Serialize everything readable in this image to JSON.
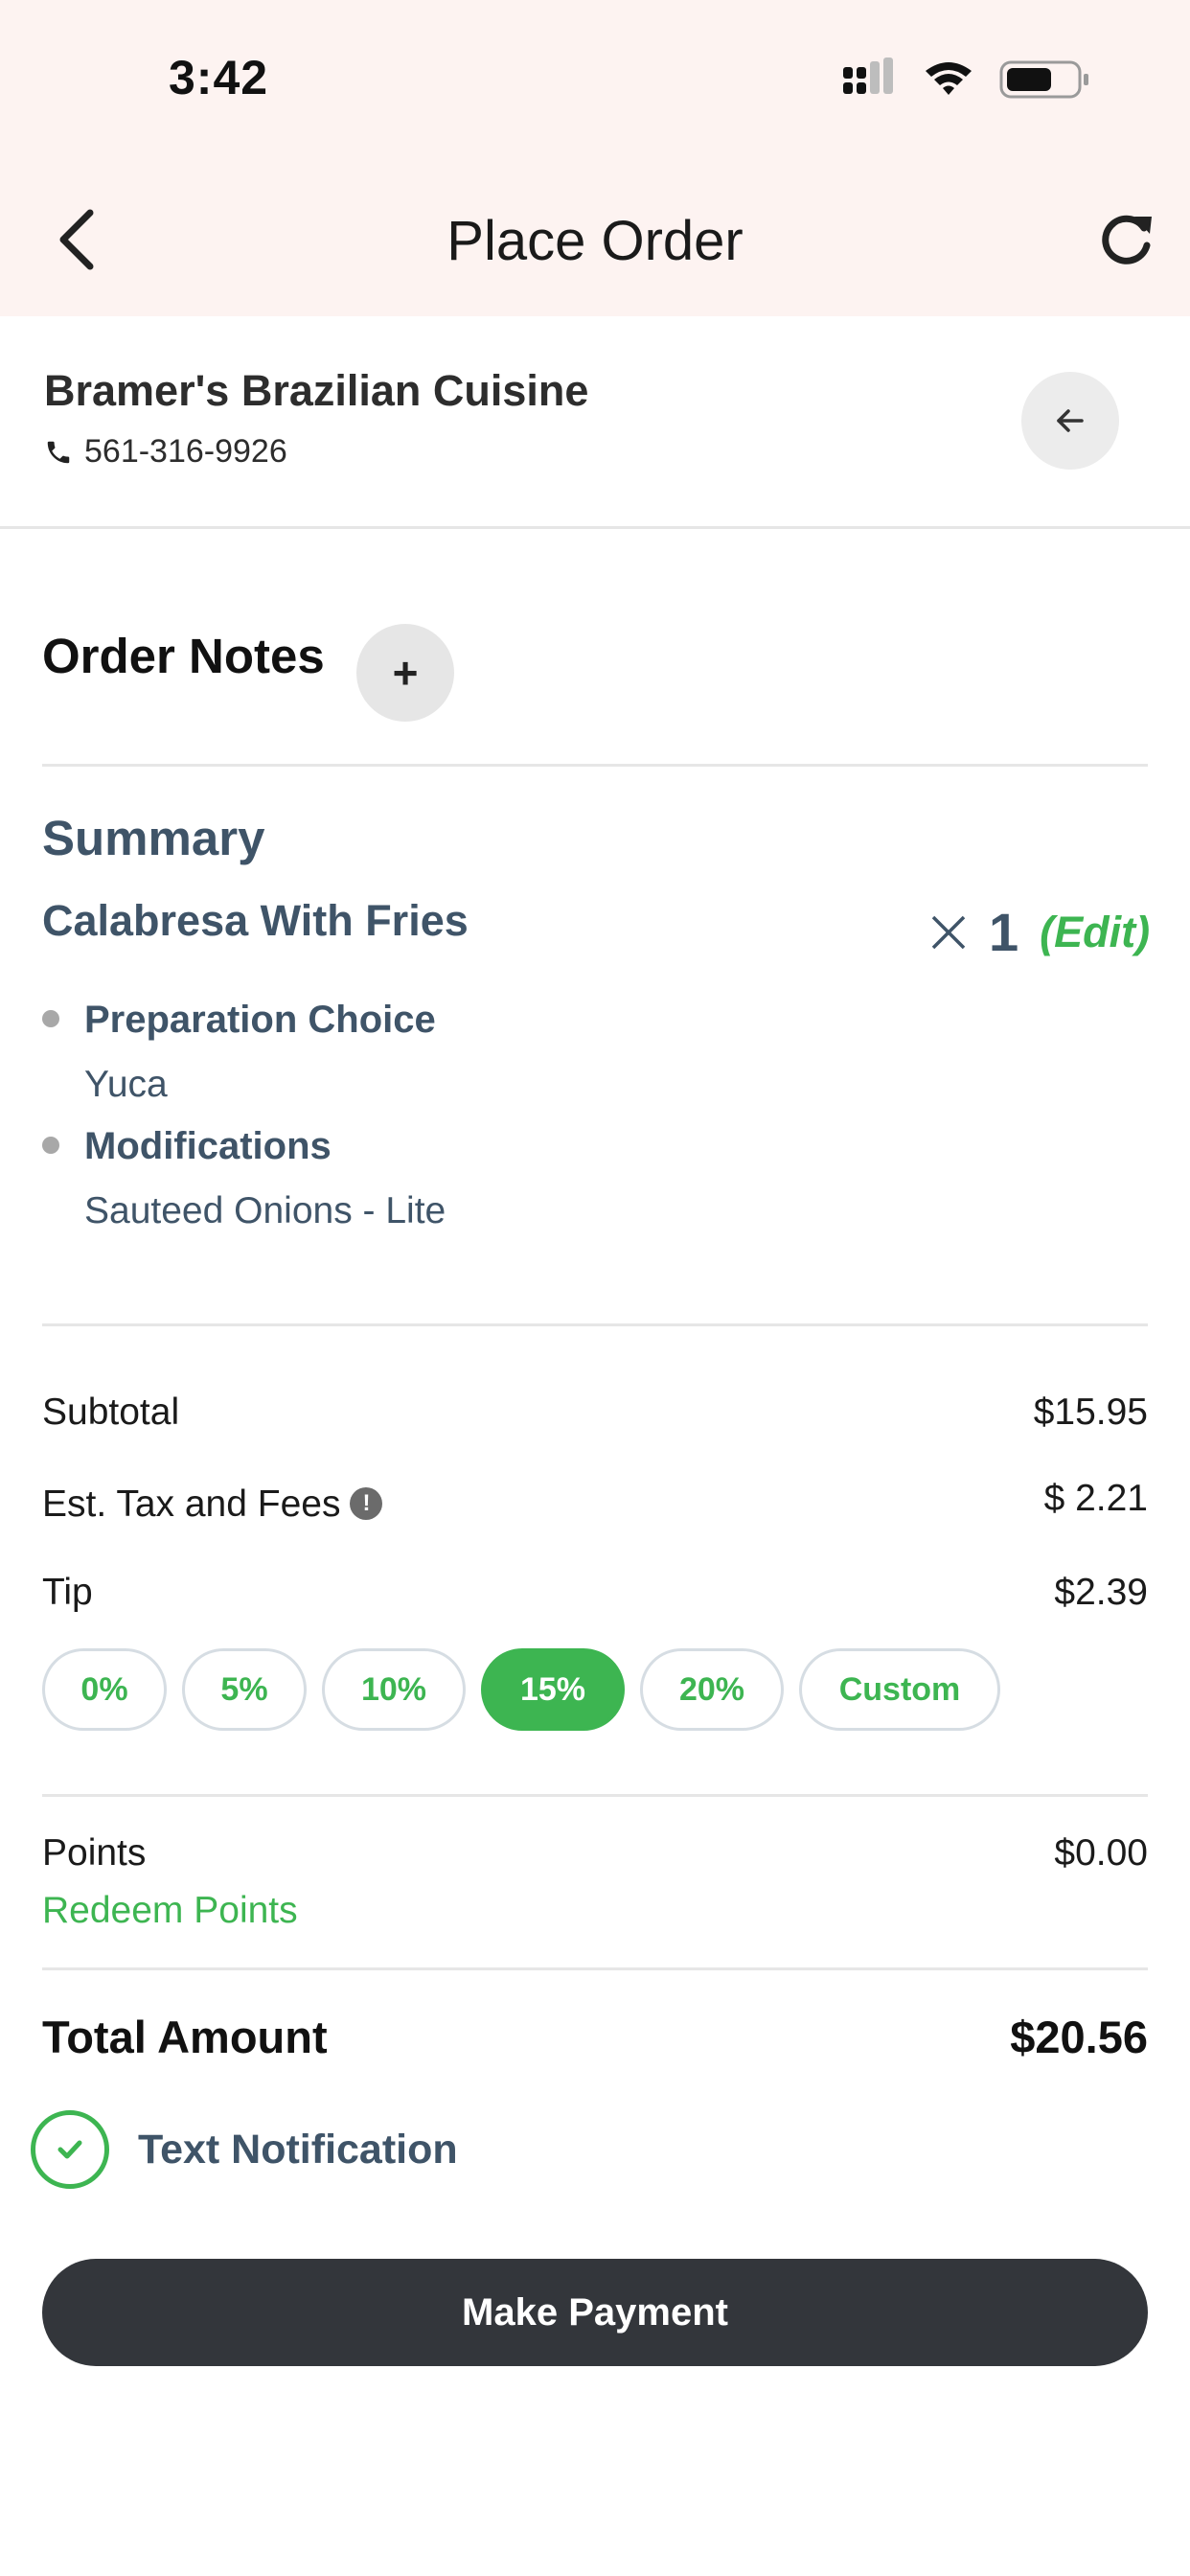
{
  "status_bar": {
    "time": "3:42"
  },
  "nav": {
    "title": "Place Order"
  },
  "restaurant": {
    "name": "Bramer's Brazilian Cuisine",
    "phone": "561-316-9926"
  },
  "order_notes": {
    "title": "Order Notes",
    "add_label": "+"
  },
  "summary": {
    "title": "Summary",
    "items": [
      {
        "name": "Calabresa With Fries",
        "quantity": "1",
        "edit_label": "(Edit)",
        "options": [
          {
            "label": "Preparation Choice",
            "value": "Yuca"
          },
          {
            "label": "Modifications",
            "value": "Sauteed Onions - Lite"
          }
        ]
      }
    ]
  },
  "totals": {
    "subtotal_label": "Subtotal",
    "subtotal_value": "$15.95",
    "tax_label": "Est. Tax and Fees",
    "tax_value": "$ 2.21",
    "tip_label": "Tip",
    "tip_value": "$2.39",
    "tip_options": [
      "0%",
      "5%",
      "10%",
      "15%",
      "20%",
      "Custom"
    ],
    "tip_selected": "15%",
    "points_label": "Points",
    "points_value": "$0.00",
    "redeem_label": "Redeem Points",
    "total_label": "Total Amount",
    "total_value": "$20.56"
  },
  "notification": {
    "label": "Text Notification",
    "checked": true
  },
  "payment": {
    "button_label": "Make Payment"
  },
  "colors": {
    "accent": "#3db551",
    "header_bg": "#fdf3f1",
    "text_slate": "#3f5468",
    "button_dark": "#33363b"
  }
}
